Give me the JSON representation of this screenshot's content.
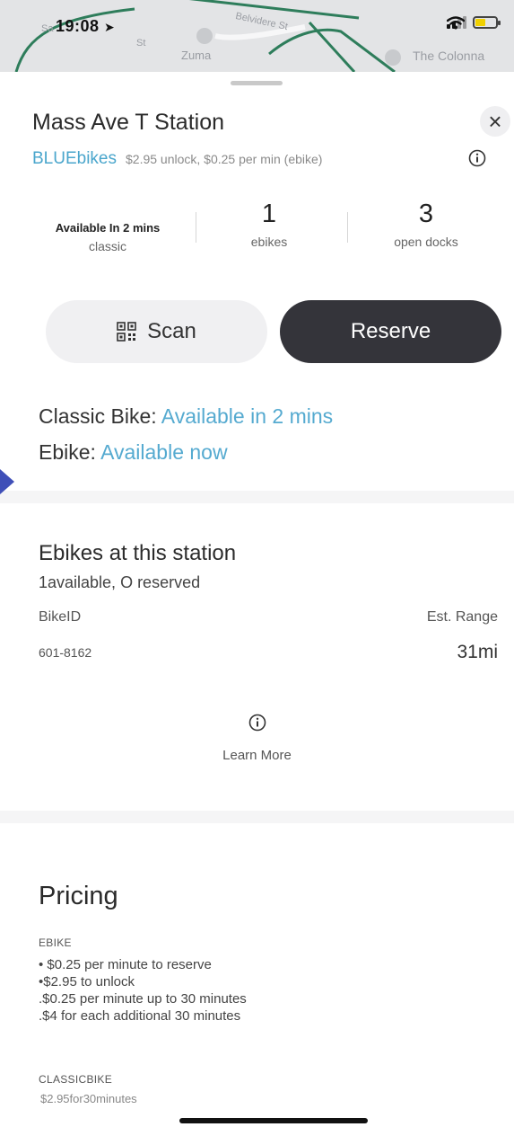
{
  "status_bar": {
    "time": "19:08"
  },
  "map": {
    "labels": [
      "Sa",
      "St",
      "Zuma",
      "Belvidere St",
      "The Colonna"
    ]
  },
  "station": {
    "name": "Mass Ave T Station",
    "operator": "BLUEbikes",
    "price_summary": "$2.95 unlock, $0.25 per min (ebike)",
    "close_label": "×"
  },
  "stats": {
    "classic_value": "Available In 2 mins",
    "classic_label": "classic",
    "ebikes_value": "1",
    "ebikes_label": "ebikes",
    "docks_value": "3",
    "docks_label": "open docks"
  },
  "actions": {
    "scan_label": "Scan",
    "reserve_label": "Reserve"
  },
  "availability": {
    "classic_prefix": "Classic Bike:",
    "classic_status": "Available in 2 mins",
    "ebike_prefix": "Ebike:",
    "ebike_status": "Available now"
  },
  "ebikes_section": {
    "title": "Ebikes at this station",
    "subtitle": "1available, O reserved",
    "col_bike_id": "BikeID",
    "col_range": "Est. Range",
    "rows": [
      {
        "bike_id": "601-8162",
        "range": "31mi"
      }
    ],
    "learn_more": "Learn More"
  },
  "pricing": {
    "title": "Pricing",
    "ebike_header": "EBIKE",
    "ebike_lines": [
      "• $0.25 per minute to reserve",
      "•$2.95 to unlock",
      ".$0.25 per minute up to 30 minutes",
      ".$4 for each additional 30 minutes"
    ],
    "classic_header": "CLASSICBIKE",
    "classic_lines": [
      "$2.95for30minutes"
    ]
  },
  "colors": {
    "accent_blue": "#4aa6cc",
    "reserve_bg": "#34343a",
    "arrow": "#3f4fb8"
  }
}
